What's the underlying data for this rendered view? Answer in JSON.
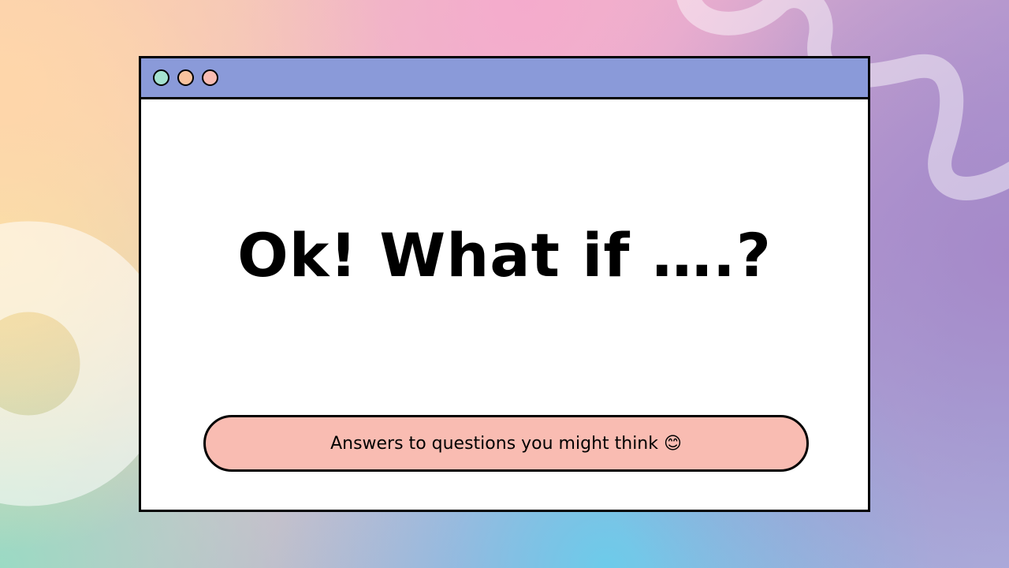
{
  "window": {
    "titlebar_color": "#8a9ad9",
    "controls": [
      {
        "name": "window-control-mint",
        "color": "#a4e2d0"
      },
      {
        "name": "window-control-peach",
        "color": "#f8c39e"
      },
      {
        "name": "window-control-pink",
        "color": "#f9bcb2"
      }
    ]
  },
  "slide": {
    "title": "Ok! What if ….?",
    "subtitle": "Answers to questions you might think 😊",
    "subtitle_pill_color": "#f9bcb2"
  },
  "decorations": {
    "top_right": "squiggle-line",
    "bottom_left": "ring-shape"
  }
}
